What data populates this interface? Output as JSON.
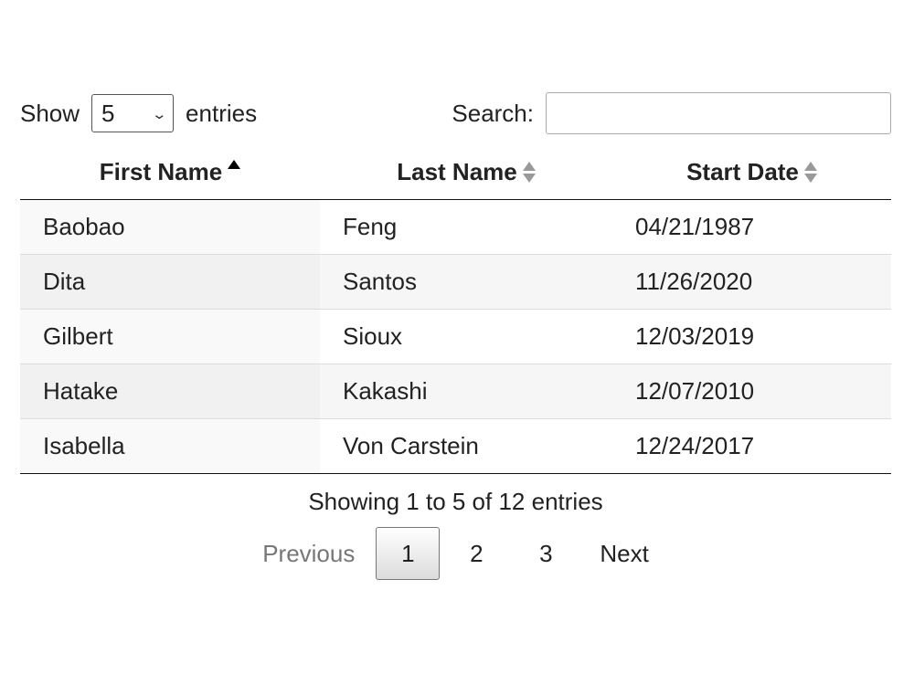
{
  "length_menu": {
    "prefix": "Show",
    "selected": "5",
    "suffix": "entries",
    "icon": "chevron-down-icon"
  },
  "filter": {
    "label": "Search:",
    "value": "",
    "placeholder": ""
  },
  "table": {
    "columns": [
      {
        "label": "First Name",
        "sort": "ascending"
      },
      {
        "label": "Last Name",
        "sort": "none"
      },
      {
        "label": "Start Date",
        "sort": "none"
      }
    ],
    "rows": [
      {
        "first": "Baobao",
        "last": "Feng",
        "date": "04/21/1987"
      },
      {
        "first": "Dita",
        "last": "Santos",
        "date": "11/26/2020"
      },
      {
        "first": "Gilbert",
        "last": "Sioux",
        "date": "12/03/2019"
      },
      {
        "first": "Hatake",
        "last": "Kakashi",
        "date": "12/07/2010"
      },
      {
        "first": "Isabella",
        "last": "Von Carstein",
        "date": "12/24/2017"
      }
    ]
  },
  "info": "Showing 1 to 5 of 12 entries",
  "pagination": {
    "previous": "Previous",
    "pages": [
      "1",
      "2",
      "3"
    ],
    "current": "1",
    "next": "Next"
  }
}
